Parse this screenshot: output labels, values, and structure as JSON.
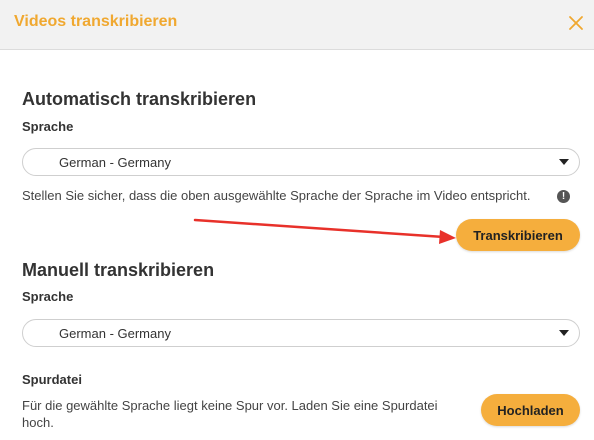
{
  "dialog": {
    "title": "Videos transkribieren",
    "close_icon": "close-icon",
    "accent_color": "#f0a830"
  },
  "auto": {
    "heading": "Automatisch transkribieren",
    "language_label": "Sprache",
    "language_value": "German - Germany",
    "hint": "Stellen Sie sicher, dass die oben ausgewählte Sprache der Sprache im Video entspricht.",
    "info_icon": "info-icon",
    "info_glyph": "!",
    "button_label": "Transkribieren",
    "button_color": "#f5ae3d"
  },
  "manual": {
    "heading": "Manuell transkribieren",
    "language_label": "Sprache",
    "language_value": "German - Germany",
    "track_label": "Spurdatei",
    "track_text": "Für die gewählte Sprache liegt keine Spur vor. Laden Sie eine Spurdatei hoch.",
    "upload_button_label": "Hochladen"
  },
  "annotation": {
    "arrow_color": "#e8312a"
  }
}
